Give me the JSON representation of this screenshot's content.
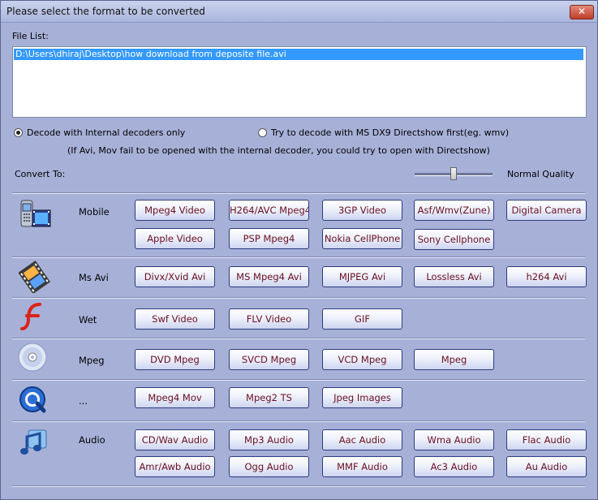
{
  "window": {
    "title": "Please select the format to be converted",
    "close_glyph": "✕"
  },
  "file_list": {
    "label": "File List:",
    "items": [
      "D:\\Users\\dhiraj\\Desktop\\how download from deposite file.avi"
    ]
  },
  "decode": {
    "internal_label": "Decode with Internal decoders only",
    "directshow_label": "Try to decode with MS DX9 Directshow first(eg. wmv)",
    "hint": "(If Avi, Mov fail to be opened with the internal decoder, you could try to open with Directshow)",
    "selected": "internal"
  },
  "convert_to": {
    "label": "Convert To:",
    "quality_label": "Normal Quality",
    "quality_level": 0.5
  },
  "categories": {
    "mobile": {
      "label": "Mobile",
      "icon": "mobile-phone-icon",
      "buttons": [
        "Mpeg4 Video",
        "H264/AVC Mpeg4",
        "3GP Video",
        "Asf/Wmv(Zune)",
        "Digital Camera",
        "Apple Video",
        "PSP Mpeg4",
        "Nokia CellPhone",
        "Sony Cellphone"
      ]
    },
    "msavi": {
      "label": "Ms Avi",
      "icon": "film-reel-icon",
      "buttons": [
        "Divx/Xvid Avi",
        "MS Mpeg4 Avi",
        "MJPEG Avi",
        "Lossless Avi",
        "h264 Avi"
      ]
    },
    "web": {
      "label": "Wet",
      "icon": "flash-icon",
      "buttons": [
        "Swf Video",
        "FLV Video",
        "GIF"
      ]
    },
    "mpeg": {
      "label": "Mpeg",
      "icon": "disc-icon",
      "buttons": [
        "DVD Mpeg",
        "SVCD Mpeg",
        "VCD Mpeg",
        "Mpeg"
      ]
    },
    "other": {
      "label": "...",
      "icon": "quicktime-icon",
      "buttons": [
        "Mpeg4 Mov",
        "Mpeg2 TS",
        "Jpeg Images"
      ]
    },
    "audio": {
      "label": "Audio",
      "icon": "music-note-icon",
      "buttons": [
        "CD/Wav Audio",
        "Mp3 Audio",
        "Aac Audio",
        "Wma Audio",
        "Flac Audio",
        "Amr/Awb Audio",
        "Ogg  Audio",
        "MMF Audio",
        "Ac3 Audio",
        "Au  Audio"
      ]
    }
  }
}
